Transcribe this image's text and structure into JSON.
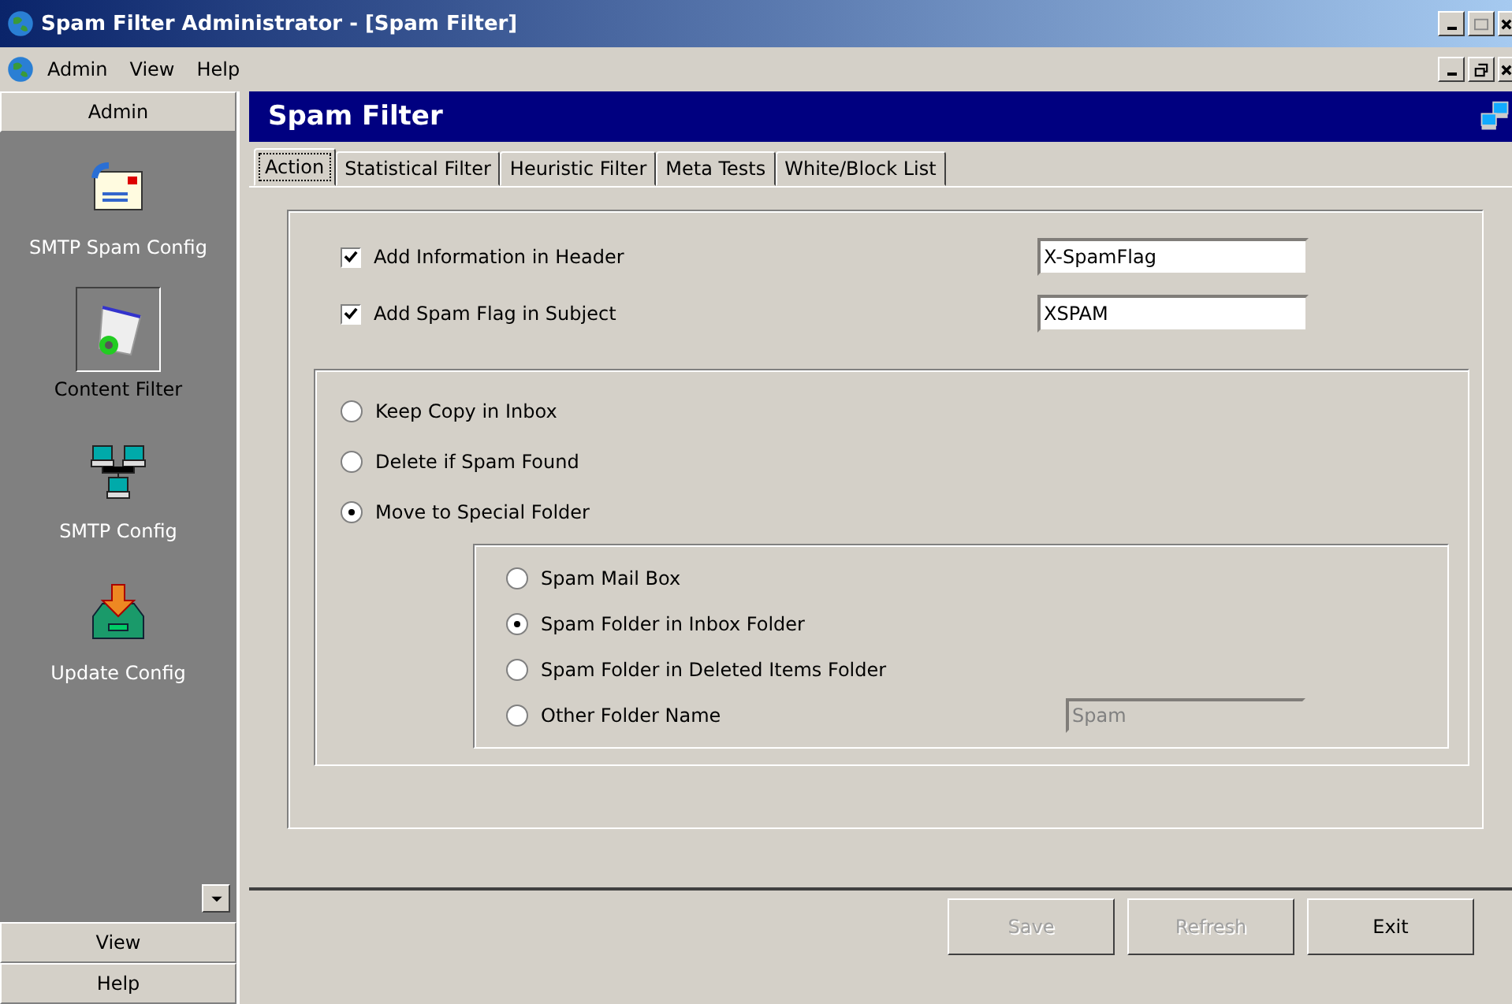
{
  "window": {
    "title": "Spam Filter Administrator - [Spam Filter]"
  },
  "menu": [
    {
      "label": "Admin"
    },
    {
      "label": "View"
    },
    {
      "label": "Help"
    }
  ],
  "sidebar": {
    "header": "Admin",
    "items": [
      {
        "label": "SMTP Spam Config",
        "kind": "mail",
        "selected": false
      },
      {
        "label": "Content Filter",
        "kind": "filter",
        "selected": true
      },
      {
        "label": "SMTP Config",
        "kind": "network",
        "selected": false
      },
      {
        "label": "Update Config",
        "kind": "inbox",
        "selected": false
      }
    ],
    "sections": [
      {
        "label": "View"
      },
      {
        "label": "Help"
      }
    ]
  },
  "panel": {
    "title": "Spam Filter"
  },
  "tabs": [
    {
      "label": "Action",
      "selected": true
    },
    {
      "label": "Statistical Filter",
      "selected": false
    },
    {
      "label": "Heuristic Filter",
      "selected": false
    },
    {
      "label": "Meta Tests",
      "selected": false
    },
    {
      "label": "White/Block List",
      "selected": false
    }
  ],
  "header_options": [
    {
      "label": "Add Information in Header",
      "checked": true,
      "value": "X-SpamFlag"
    },
    {
      "label": "Add Spam Flag in Subject",
      "checked": true,
      "value": "XSPAM"
    }
  ],
  "action_options": [
    {
      "label": "Keep Copy in Inbox",
      "selected": false
    },
    {
      "label": "Delete if Spam Found",
      "selected": false
    },
    {
      "label": "Move to Special Folder",
      "selected": true
    }
  ],
  "folder_options": [
    {
      "label": "Spam Mail Box",
      "selected": false
    },
    {
      "label": "Spam Folder in Inbox Folder",
      "selected": true
    },
    {
      "label": "Spam Folder in Deleted Items Folder",
      "selected": false
    },
    {
      "label": "Other Folder Name",
      "selected": false
    }
  ],
  "other_folder": {
    "value": "Spam",
    "disabled": true
  },
  "buttons": [
    {
      "label": "Save",
      "disabled": true
    },
    {
      "label": "Refresh",
      "disabled": true
    },
    {
      "label": "Exit",
      "disabled": false
    }
  ]
}
